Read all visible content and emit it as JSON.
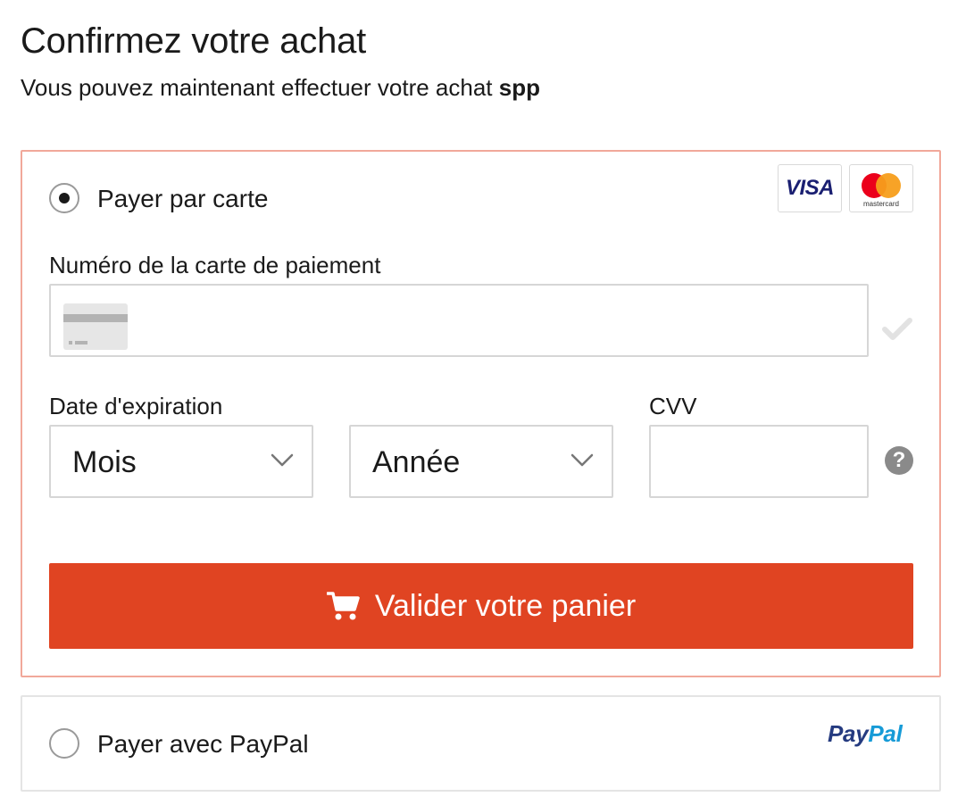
{
  "header": {
    "title": "Confirmez votre achat",
    "subtitle_prefix": "Vous pouvez maintenant effectuer votre achat",
    "subtitle_product": "spp"
  },
  "card_option": {
    "label": "Payer par carte",
    "selected": true,
    "brands": {
      "visa": "VISA",
      "mastercard": "mastercard"
    },
    "card_number": {
      "label": "Numéro de la carte de paiement",
      "value": "",
      "icon": "credit-card-icon",
      "status_icon": "check-icon"
    },
    "expiration": {
      "label": "Date d'expiration",
      "month_value": "Mois",
      "year_value": "Année"
    },
    "cvv": {
      "label": "CVV",
      "value": "",
      "help_icon": "?"
    },
    "submit": {
      "label": "Valider votre panier",
      "icon": "cart-icon"
    }
  },
  "paypal_option": {
    "label": "Payer avec PayPal",
    "selected": false,
    "logo_part1": "Pay",
    "logo_part2": "Pal"
  },
  "colors": {
    "accent": "#e04422",
    "selected_border": "#f1a89a",
    "paypal_dark": "#253b80",
    "paypal_light": "#179bd7"
  }
}
